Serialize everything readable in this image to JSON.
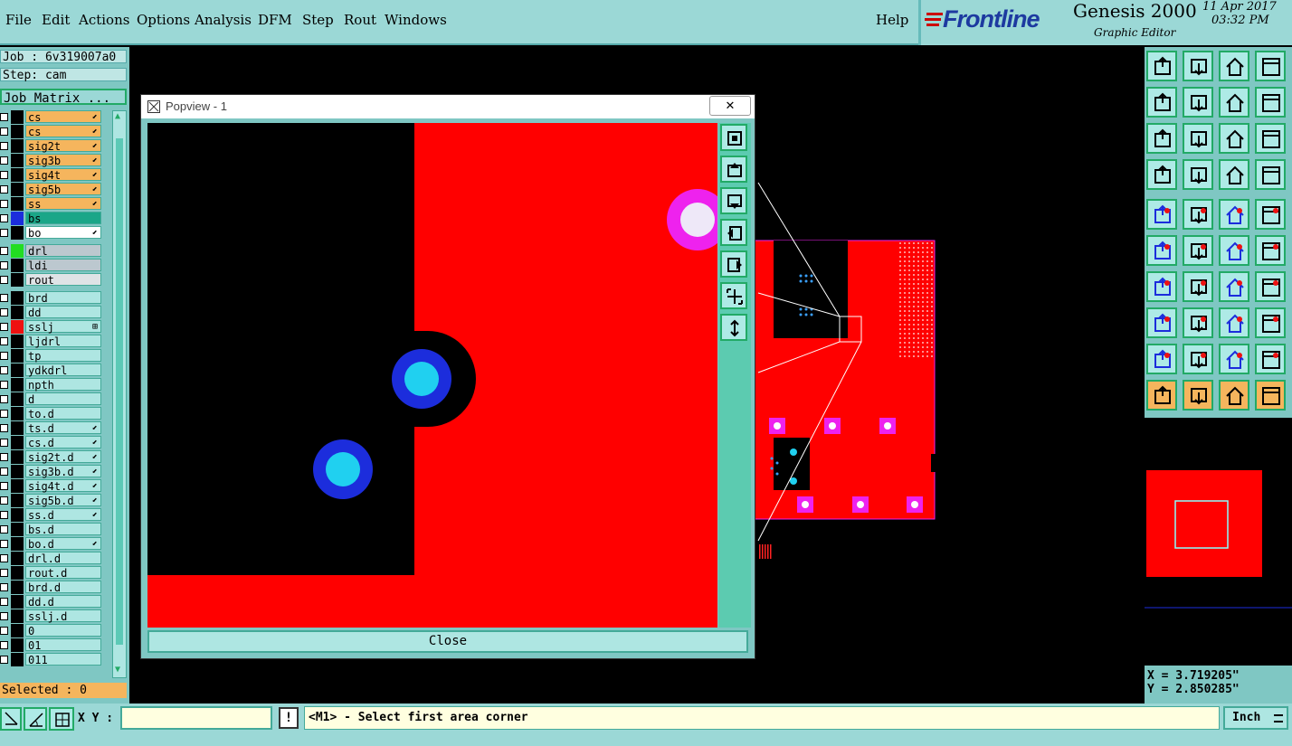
{
  "menubar": {
    "items": [
      "File",
      "Edit",
      "Actions",
      "Options",
      "Analysis",
      "DFM",
      "Step",
      "Rout",
      "Windows"
    ],
    "help": "Help"
  },
  "brand": {
    "logo": "Frontline",
    "product": "Genesis 2000",
    "subtitle": "Graphic Editor",
    "date": "11 Apr 2017",
    "time": "03:32 PM"
  },
  "left": {
    "job": "Job : 6v319007a0",
    "step": "Step: cam",
    "matrix_button": "Job Matrix ...",
    "selected": "Selected : 0"
  },
  "layers": [
    {
      "name": "cs",
      "bg": "#f5b55d",
      "swatch": "",
      "mark": "⬋"
    },
    {
      "name": "cs",
      "bg": "#f5b55d",
      "swatch": "",
      "mark": "⬋"
    },
    {
      "name": "sig2t",
      "bg": "#f5b55d",
      "swatch": "",
      "mark": "⬋"
    },
    {
      "name": "sig3b",
      "bg": "#f5b55d",
      "swatch": "",
      "mark": "⬋"
    },
    {
      "name": "sig4t",
      "bg": "#f5b55d",
      "swatch": "",
      "mark": "⬋"
    },
    {
      "name": "sig5b",
      "bg": "#f5b55d",
      "swatch": "",
      "mark": "⬋"
    },
    {
      "name": "ss",
      "bg": "#f5b55d",
      "swatch": "",
      "mark": "⬋"
    },
    {
      "name": "bs",
      "bg": "#1aa688",
      "swatch": "#1c2ddc",
      "mark": ""
    },
    {
      "name": "bo",
      "bg": "#ffffff",
      "swatch": "",
      "mark": "⬋"
    },
    {
      "name": "drl",
      "bg": "#bcc8cf",
      "swatch": "#22dd22",
      "mark": ""
    },
    {
      "name": "ldi",
      "bg": "#bcc8cf",
      "swatch": "",
      "mark": ""
    },
    {
      "name": "rout",
      "bg": "#dfe3e6",
      "swatch": "",
      "mark": ""
    },
    {
      "name": "brd",
      "bg": "#aee6e2",
      "swatch": "",
      "mark": ""
    },
    {
      "name": "dd",
      "bg": "#aee6e2",
      "swatch": "",
      "mark": ""
    },
    {
      "name": "sslj",
      "bg": "#aee6e2",
      "swatch": "#ee1111",
      "mark": "⊞"
    },
    {
      "name": "ljdrl",
      "bg": "#aee6e2",
      "swatch": "",
      "mark": ""
    },
    {
      "name": "tp",
      "bg": "#aee6e2",
      "swatch": "",
      "mark": ""
    },
    {
      "name": "ydkdrl",
      "bg": "#aee6e2",
      "swatch": "",
      "mark": ""
    },
    {
      "name": "npth",
      "bg": "#aee6e2",
      "swatch": "",
      "mark": ""
    },
    {
      "name": "d",
      "bg": "#aee6e2",
      "swatch": "",
      "mark": ""
    },
    {
      "name": "to.d",
      "bg": "#aee6e2",
      "swatch": "",
      "mark": ""
    },
    {
      "name": "ts.d",
      "bg": "#aee6e2",
      "swatch": "",
      "mark": "⬋"
    },
    {
      "name": "cs.d",
      "bg": "#aee6e2",
      "swatch": "",
      "mark": "⬋"
    },
    {
      "name": "sig2t.d",
      "bg": "#aee6e2",
      "swatch": "",
      "mark": "⬋"
    },
    {
      "name": "sig3b.d",
      "bg": "#aee6e2",
      "swatch": "",
      "mark": "⬋"
    },
    {
      "name": "sig4t.d",
      "bg": "#aee6e2",
      "swatch": "",
      "mark": "⬋"
    },
    {
      "name": "sig5b.d",
      "bg": "#aee6e2",
      "swatch": "",
      "mark": "⬋"
    },
    {
      "name": "ss.d",
      "bg": "#aee6e2",
      "swatch": "",
      "mark": "⬋"
    },
    {
      "name": "bs.d",
      "bg": "#aee6e2",
      "swatch": "",
      "mark": ""
    },
    {
      "name": "bo.d",
      "bg": "#aee6e2",
      "swatch": "",
      "mark": "⬋"
    },
    {
      "name": "drl.d",
      "bg": "#aee6e2",
      "swatch": "",
      "mark": ""
    },
    {
      "name": "rout.d",
      "bg": "#aee6e2",
      "swatch": "",
      "mark": ""
    },
    {
      "name": "brd.d",
      "bg": "#aee6e2",
      "swatch": "",
      "mark": ""
    },
    {
      "name": "dd.d",
      "bg": "#aee6e2",
      "swatch": "",
      "mark": ""
    },
    {
      "name": "sslj.d",
      "bg": "#aee6e2",
      "swatch": "",
      "mark": ""
    },
    {
      "name": "0",
      "bg": "#aee6e2",
      "swatch": "",
      "mark": ""
    },
    {
      "name": "01",
      "bg": "#aee6e2",
      "swatch": "",
      "mark": ""
    },
    {
      "name": "011",
      "bg": "#aee6e2",
      "swatch": "",
      "mark": ""
    }
  ],
  "popview": {
    "title": "Popview - 1",
    "close_x": "✕",
    "close_label": "Close"
  },
  "coords": {
    "x": "X = 3.719205\"",
    "y": "Y = 2.850285\""
  },
  "status": {
    "xy_label": "X Y :",
    "xy_value": "",
    "info_icon": "!",
    "message": "<M1> - Select first area corner",
    "units": "Inch"
  },
  "colors": {
    "panel": "#7fc7c3",
    "menubar": "#9bd8d6",
    "board_red": "#ff0000",
    "pad_blue": "#1c2ddc",
    "pad_cyan": "#20d0f0",
    "pad_magenta": "#ee22ee"
  }
}
